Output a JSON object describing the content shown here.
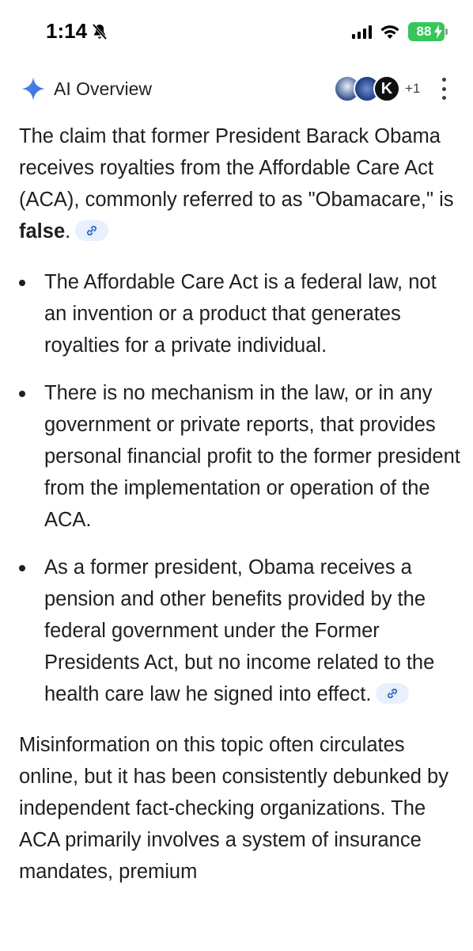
{
  "status_bar": {
    "time": "1:14",
    "battery": "88"
  },
  "overview": {
    "title": "AI Overview",
    "sources_more": "+1",
    "source_k_letter": "K"
  },
  "intro": {
    "text_before": "The claim that former President Barack Obama receives royalties from the Affordable Care Act (ACA), commonly referred to as \"Obamacare,\" is ",
    "bold": "false",
    "text_after": "."
  },
  "bullets": [
    "The Affordable Care Act is a federal law, not an invention or a product that generates royalties for a private individual.",
    "There is no mechanism in the law, or in any government or private reports, that provides personal financial profit to the former president from the implementation or operation of the ACA.",
    "As a former president, Obama receives a pension and other benefits provided by the federal government under the Former Presidents Act, but no income related to the health care law he signed into effect."
  ],
  "closing": "Misinformation on this topic often circulates online, but it has been consistently debunked by independent fact-checking organizations. The ACA primarily involves a system of insurance mandates, premium"
}
